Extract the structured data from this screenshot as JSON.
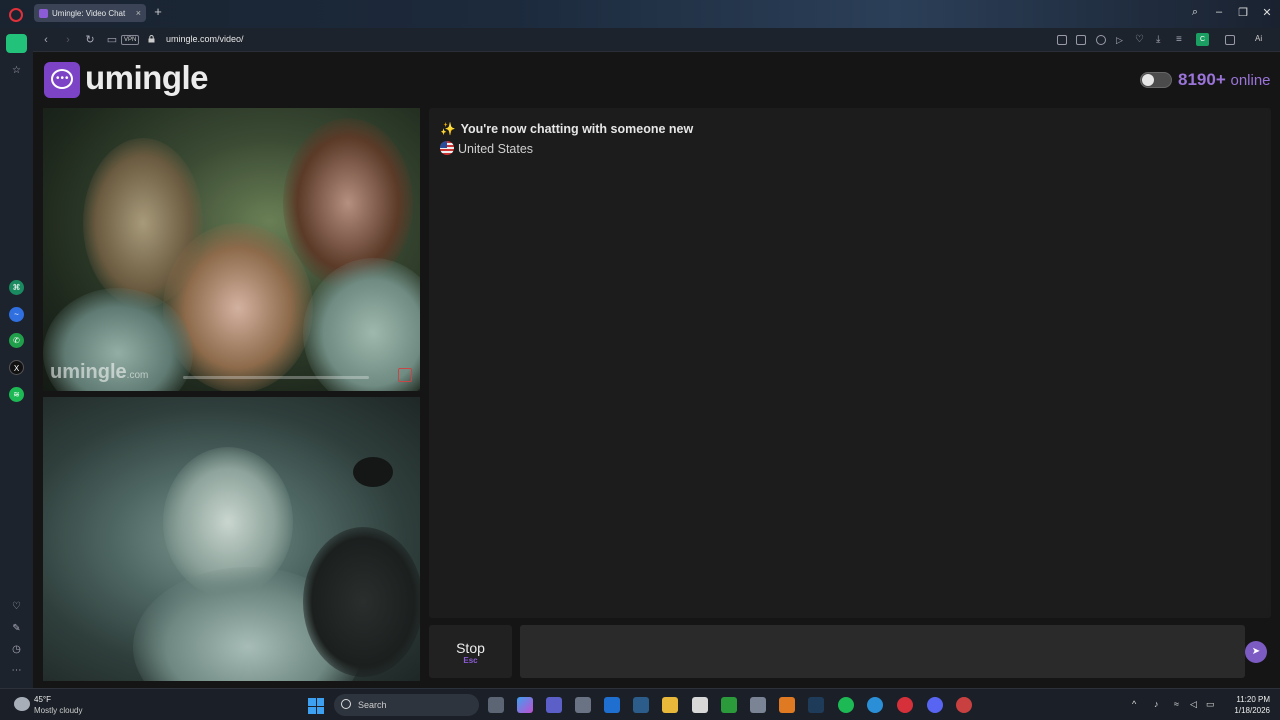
{
  "browser": {
    "tab_title": "Umingle: Video Chat",
    "tab_close": "×",
    "new_tab": "+",
    "url": "umingle.com/video/",
    "vpn_label": "VPN",
    "ext_c_label": "C",
    "ai_label": "Ai",
    "window_controls": {
      "search": "⌕",
      "minimize": "–",
      "restore": "❐",
      "close": "✕"
    },
    "nav": {
      "back": "‹",
      "forward": "›",
      "reload": "↻"
    }
  },
  "site": {
    "logo_text": "umingle",
    "online_count": "8190+",
    "online_label": "online",
    "brand_color": "#7c43c6"
  },
  "video": {
    "watermark": "umingle",
    "watermark_suffix": ".com"
  },
  "chat": {
    "status_icon": "✨",
    "status": "You're now chatting with someone new",
    "country": "United States",
    "stop_label": "Stop",
    "stop_key": "Esc",
    "input_value": "",
    "send_icon": "➤"
  },
  "taskbar": {
    "weather_temp": "45°F",
    "weather_desc": "Mostly cloudy",
    "search_label": "Search",
    "time": "11:20 PM",
    "date": "1/18/2026"
  }
}
